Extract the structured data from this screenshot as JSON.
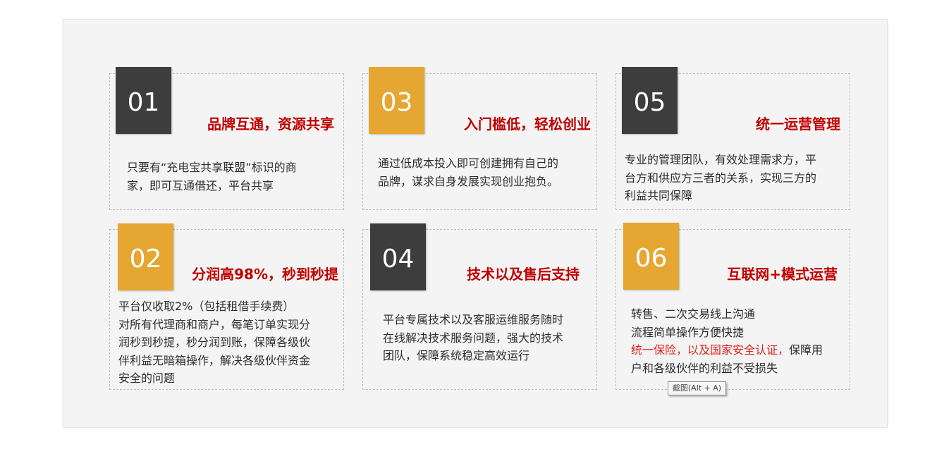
{
  "cards": [
    {
      "num": "01",
      "title": "品牌互通，资源共享",
      "lines": [
        "只要有“充电宝共享联盟”标识的商",
        "家，即可互通借还，平台共享"
      ]
    },
    {
      "num": "03",
      "title": "入门槛低，轻松创业",
      "lines": [
        "通过低成本投入即可创建拥有自己的",
        "品牌，谋求自身发展实现创业抱负。"
      ]
    },
    {
      "num": "05",
      "title": "统一运营管理",
      "lines": [
        "专业的管理团队，有效处理需求方，平",
        "台方和供应方三者的关系，实现三方的",
        "利益共同保障"
      ]
    },
    {
      "num": "02",
      "title": "分润高98%，秒到秒提",
      "lines": [
        "平台仅收取2%（包括租借手续费）",
        "对所有代理商和商户，每笔订单实现分",
        "润秒到秒提，秒分润到账，保障各级伙",
        "伴利益无暗箱操作，解决各级伙伴资金",
        "安全的问题"
      ]
    },
    {
      "num": "04",
      "title": "技术以及售后支持",
      "lines": [
        "平台专属技术以及客服运维服务随时",
        "在线解决技术服务问题，强大的技术",
        "团队，保障系统稳定高效运行"
      ]
    },
    {
      "num": "06",
      "title": "互联网+模式运营",
      "lines": [
        "转售、二次交易线上沟通",
        "流程简单操作方便快捷"
      ],
      "line3_red": "统一保险，以及国家安全认证，",
      "line3_rest": "保障用",
      "line4": "户和各级伙伴的利益不受损失"
    }
  ],
  "tooltip": "截图(Alt + A)",
  "colors": {
    "dark_box": "#3d3d3d",
    "gold_box": "#e5a732",
    "title_red": "#c00000",
    "highlight_red": "#e0211a"
  }
}
